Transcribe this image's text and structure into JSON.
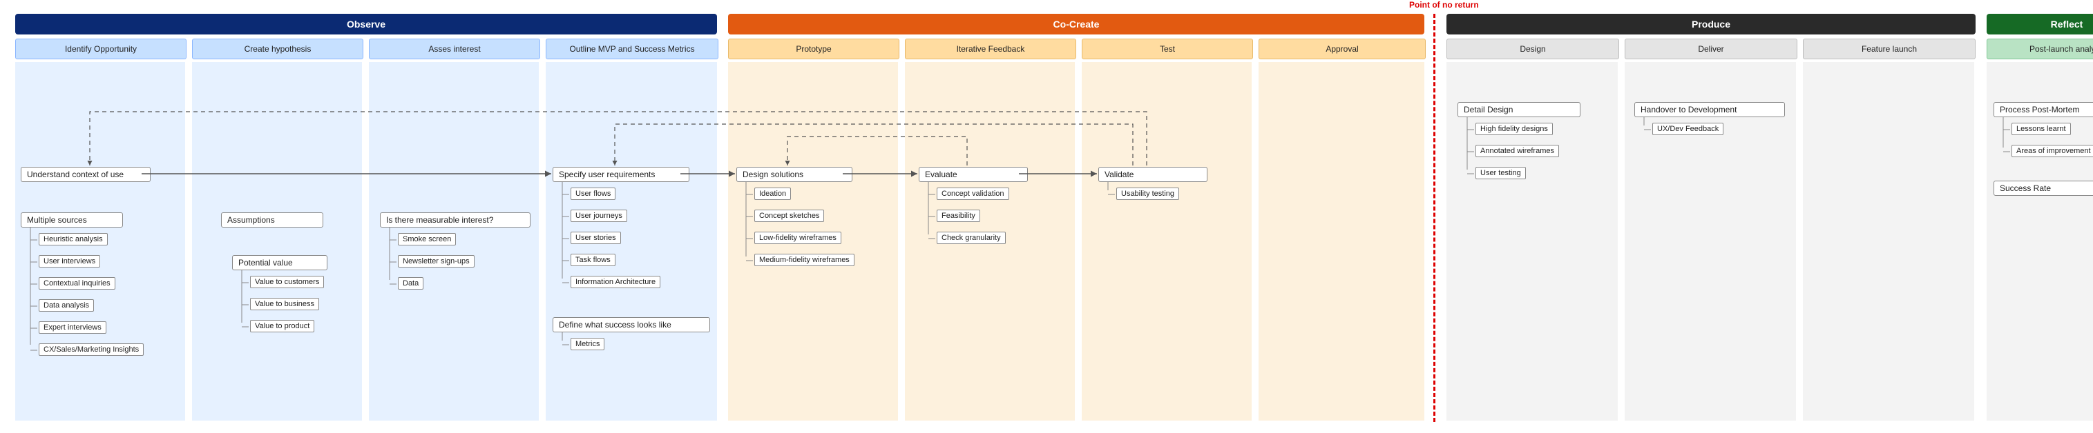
{
  "point_of_no_return": "Point of no return",
  "phases": {
    "observe": "Observe",
    "cocreate": "Co-Create",
    "produce": "Produce",
    "reflect": "Reflect"
  },
  "lanes": {
    "o1": "Identify Opportunity",
    "o2": "Create hypothesis",
    "o3": "Asses interest",
    "o4": "Outline MVP and Success Metrics",
    "c1": "Prototype",
    "c2": "Iterative Feedback",
    "c3": "Test",
    "c4": "Approval",
    "p1": "Design",
    "p2": "Deliver",
    "p3": "Feature launch",
    "r1": "Post-launch analysis"
  },
  "colors": {
    "observe_header": "#0b2a73",
    "observe_lane": "#c6e0ff",
    "observe_lane_border": "#8ab6ff",
    "observe_bg": "#e6f1ff",
    "cocreate_header": "#e25a11",
    "cocreate_lane": "#ffdca0",
    "cocreate_lane_border": "#e8b96a",
    "cocreate_bg": "#fdf1dd",
    "produce_header": "#2a2a2a",
    "produce_lane": "#e4e4e4",
    "produce_lane_border": "#bdbdbd",
    "produce_bg": "#f3f3f3",
    "reflect_header": "#166a25",
    "reflect_lane": "#b9e3c4",
    "reflect_lane_border": "#7fc796",
    "reflect_bg": "#f3f3f3"
  },
  "nodes": {
    "understand": "Understand context of use",
    "multiple_sources": "Multiple sources",
    "heuristic": "Heuristic analysis",
    "user_interviews": "User interviews",
    "contextual": "Contextual inquiries",
    "data_analysis": "Data analysis",
    "expert": "Expert interviews",
    "cx": "CX/Sales/Marketing Insights",
    "assumptions": "Assumptions",
    "potential_value": "Potential value",
    "v_customers": "Value to customers",
    "v_business": "Value to business",
    "v_product": "Value to product",
    "measurable": "Is there measurable interest?",
    "smoke": "Smoke screen",
    "newsletter": "Newsletter sign-ups",
    "data": "Data",
    "specify": "Specify user requirements",
    "user_flows": "User flows",
    "user_journeys": "User journeys",
    "user_stories": "User stories",
    "task_flows": "Task flows",
    "ia": "Information Architecture",
    "define": "Define what success looks like",
    "metrics": "Metrics",
    "design_solutions": "Design solutions",
    "ideation": "Ideation",
    "concept_sketches": "Concept sketches",
    "lofi": "Low-fidelity wireframes",
    "medfi": "Medium-fidelity wireframes",
    "evaluate": "Evaluate",
    "concept_val": "Concept validation",
    "feasibility": "Feasibility",
    "granularity": "Check granularity",
    "validate": "Validate",
    "usability": "Usability testing",
    "detail": "Detail Design",
    "hifi": "High fidelity designs",
    "anno": "Annotated wireframes",
    "user_testing": "User testing",
    "handover": "Handover to Development",
    "uxdev": "UX/Dev Feedback",
    "ppm": "Process Post-Mortem",
    "lessons": "Lessons learnt",
    "improve": "Areas of improvement",
    "success_rate": "Success Rate"
  }
}
